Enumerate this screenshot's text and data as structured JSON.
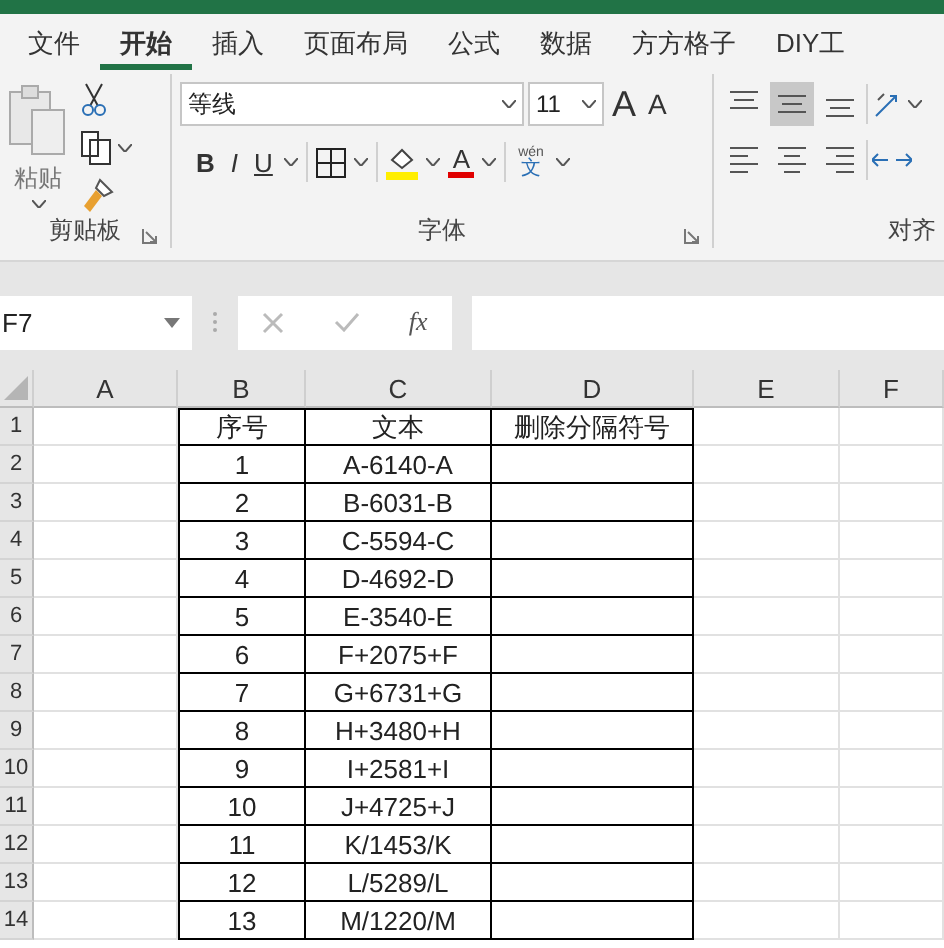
{
  "tabs": [
    {
      "label": "文件",
      "selected": false
    },
    {
      "label": "开始",
      "selected": true
    },
    {
      "label": "插入",
      "selected": false
    },
    {
      "label": "页面布局",
      "selected": false
    },
    {
      "label": "公式",
      "selected": false
    },
    {
      "label": "数据",
      "selected": false
    },
    {
      "label": "方方格子",
      "selected": false
    },
    {
      "label": "DIY工",
      "selected": false
    }
  ],
  "ribbon": {
    "clipboard": {
      "paste_label": "粘贴",
      "group_label": "剪贴板"
    },
    "font": {
      "font_name": "等线",
      "font_size": "11",
      "grow": "A",
      "shrink": "A",
      "bold": "B",
      "italic": "I",
      "underline": "U",
      "font_color": "A",
      "phonetic_top": "wén",
      "phonetic_bottom": "文",
      "group_label": "字体"
    },
    "alignment": {
      "group_label": "对齐",
      "vertical": [
        {
          "kind": "top",
          "selected": false
        },
        {
          "kind": "middle",
          "selected": true
        },
        {
          "kind": "bottom",
          "selected": false
        }
      ],
      "horizontal": [
        {
          "kind": "left",
          "selected": false
        },
        {
          "kind": "center",
          "selected": false
        },
        {
          "kind": "right",
          "selected": false
        }
      ]
    }
  },
  "name_box": "F7",
  "function_label": "fx",
  "sheet": {
    "columns": [
      "A",
      "B",
      "C",
      "D",
      "E",
      "F"
    ],
    "rows": [
      {
        "number": "1",
        "seq": "序号",
        "text": "文本",
        "result": "删除分隔符号"
      },
      {
        "number": "2",
        "seq": "1",
        "text": "A-6140-A"
      },
      {
        "number": "3",
        "seq": "2",
        "text": "B-6031-B"
      },
      {
        "number": "4",
        "seq": "3",
        "text": "C-5594-C"
      },
      {
        "number": "5",
        "seq": "4",
        "text": "D-4692-D"
      },
      {
        "number": "6",
        "seq": "5",
        "text": "E-3540-E"
      },
      {
        "number": "7",
        "seq": "6",
        "text": "F+2075+F"
      },
      {
        "number": "8",
        "seq": "7",
        "text": "G+6731+G"
      },
      {
        "number": "9",
        "seq": "8",
        "text": "H+3480+H"
      },
      {
        "number": "10",
        "seq": "9",
        "text": "I+2581+I"
      },
      {
        "number": "11",
        "seq": "10",
        "text": "J+4725+J"
      },
      {
        "number": "12",
        "seq": "11",
        "text": "K/1453/K"
      },
      {
        "number": "13",
        "seq": "12",
        "text": "L/5289/L"
      },
      {
        "number": "14",
        "seq": "13",
        "text": "M/1220/M"
      }
    ]
  }
}
